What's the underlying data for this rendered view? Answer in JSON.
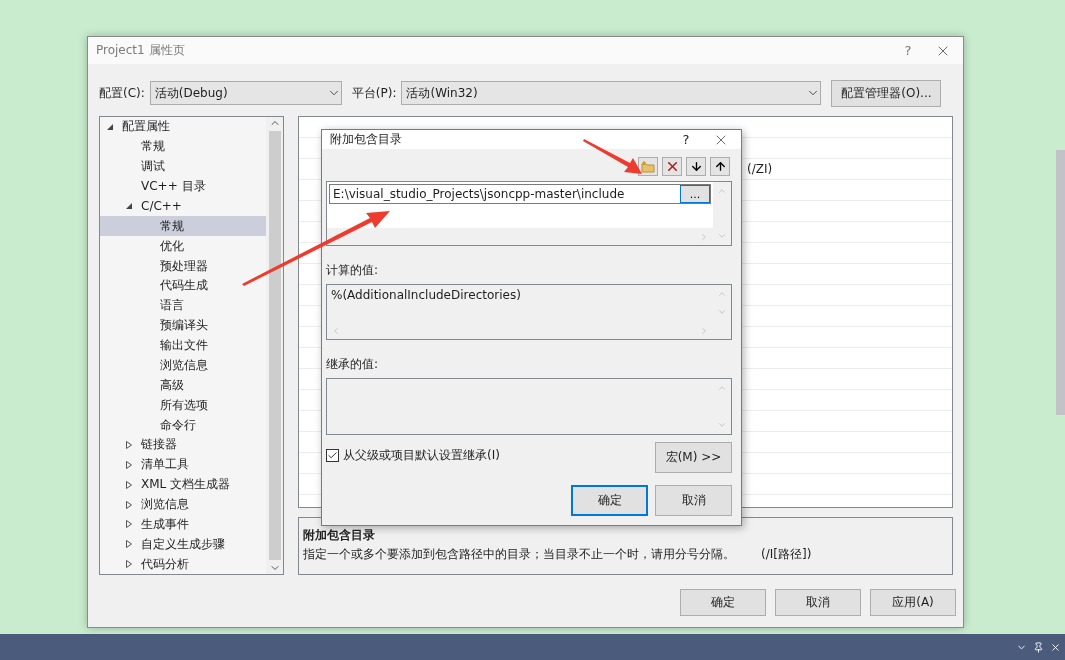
{
  "window": {
    "title": "Project1 属性页",
    "help": "?"
  },
  "config": {
    "label": "配置(C):",
    "value": "活动(Debug)"
  },
  "platform": {
    "label": "平台(P):",
    "value": "活动(Win32)"
  },
  "config_manager": "配置管理器(O)...",
  "tree": [
    {
      "label": "配置属性",
      "expanded": true,
      "selected": false,
      "children": [
        {
          "label": "常规",
          "selected": false
        },
        {
          "label": "调试",
          "selected": false
        },
        {
          "label": "VC++ 目录",
          "selected": false
        },
        {
          "label": "C/C++",
          "expanded": true,
          "selected": false,
          "children": [
            {
              "label": "常规",
              "selected": true
            },
            {
              "label": "优化",
              "selected": false
            },
            {
              "label": "预处理器",
              "selected": false
            },
            {
              "label": "代码生成",
              "selected": false
            },
            {
              "label": "语言",
              "selected": false
            },
            {
              "label": "预编译头",
              "selected": false
            },
            {
              "label": "输出文件",
              "selected": false
            },
            {
              "label": "浏览信息",
              "selected": false
            },
            {
              "label": "高级",
              "selected": false
            },
            {
              "label": "所有选项",
              "selected": false
            },
            {
              "label": "命令行",
              "selected": false
            }
          ]
        },
        {
          "label": "链接器",
          "expanded": false,
          "selected": false
        },
        {
          "label": "清单工具",
          "expanded": false,
          "selected": false
        },
        {
          "label": "XML 文档生成器",
          "expanded": false,
          "selected": false
        },
        {
          "label": "浏览信息",
          "expanded": false,
          "selected": false
        },
        {
          "label": "生成事件",
          "expanded": false,
          "selected": false
        },
        {
          "label": "自定义生成步骤",
          "expanded": false,
          "selected": false
        },
        {
          "label": "代码分析",
          "expanded": false,
          "selected": false
        }
      ]
    }
  ],
  "property_grid": {
    "rows": [
      {},
      {},
      {
        "value": "(/ZI)"
      }
    ]
  },
  "description": {
    "title": "附加包含目录",
    "text": "指定一个或多个要添加到包含路径中的目录；当目录不止一个时，请用分号分隔。",
    "switch": "(/I[路径])"
  },
  "buttons": [
    {
      "label": "确定"
    },
    {
      "label": "取消"
    },
    {
      "label": "应用(A)"
    }
  ],
  "sub_dialog": {
    "title": "附加包含目录",
    "help": "?",
    "entries": [
      {
        "value": "E:\\visual_studio_Projects\\jsoncpp-master\\include",
        "browse": "..."
      }
    ],
    "evaluated_label": "计算的值:",
    "evaluated_value": "%(AdditionalIncludeDirectories)",
    "inherited_label": "继承的值:",
    "inherit": {
      "label": "从父级或项目默认设置继承(I)",
      "checked": true
    },
    "macro_button": "宏(M) >>",
    "buttons": [
      {
        "label": "确定",
        "default": true
      },
      {
        "label": "取消",
        "default": false
      }
    ]
  }
}
